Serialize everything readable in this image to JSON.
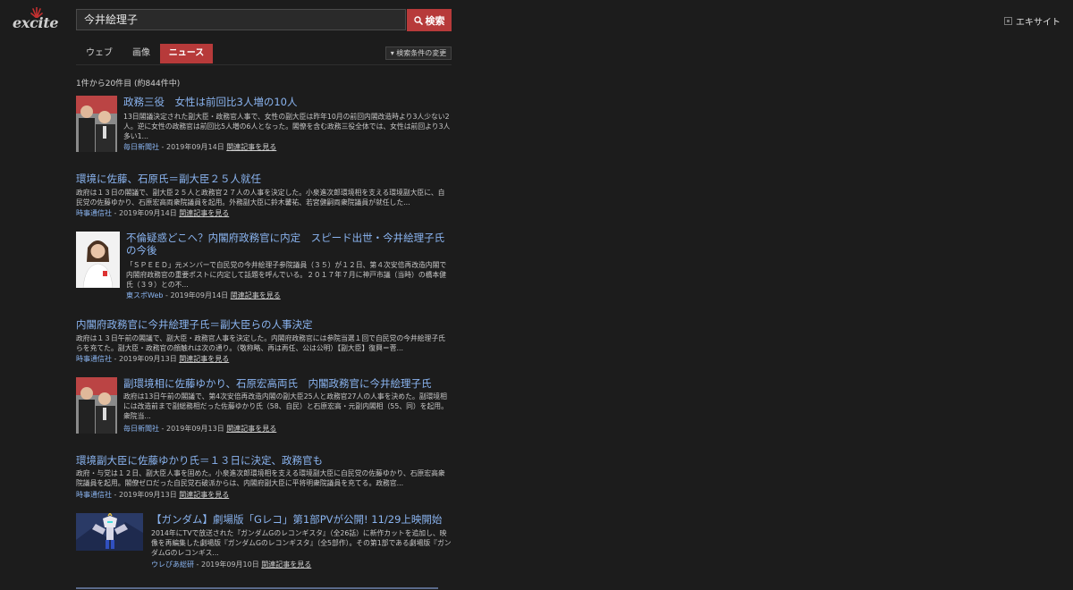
{
  "header": {
    "logo_text": "excite",
    "search_value": "今井絵理子",
    "search_button_label": "検索",
    "site_link_label": "エキサイト"
  },
  "tabs": [
    {
      "label": "ウェブ",
      "active": false
    },
    {
      "label": "画像",
      "active": false
    },
    {
      "label": "ニュース",
      "active": true
    }
  ],
  "filter_label": "検索条件の変更",
  "result_count": "1件から20件目 (約844件中)",
  "related_label": "関連記事を見る",
  "colors": {
    "accent": "#b73a3a",
    "link": "#8ab4f0",
    "background": "#1c1c1c"
  },
  "results": [
    {
      "title": "政務三役　女性は前回比3人増の10人",
      "snippet": "13日閣議決定された副大臣・政務官人事で、女性の副大臣は昨年10月の前回内閣改造時より3人少ない2人。逆に女性の政務官は前回比5人増の6人となった。閣僚を含む政務三役全体では、女性は前回より3人多い1...",
      "source": "毎日新聞社",
      "date": "2019年09月14日",
      "thumbnail": "group-photo"
    },
    {
      "title": "環境に佐藤、石原氏＝副大臣２５人就任",
      "snippet": "政府は１３日の閣議で、副大臣２５人と政務官２７人の人事を決定した。小泉進次郎環境相を支える環境副大臣に、自民党の佐藤ゆかり、石原宏高両衆院議員を起用。外務副大臣に鈴木馨祐、若宮健嗣両衆院議員が就任した...",
      "source": "時事通信社",
      "date": "2019年09月14日"
    },
    {
      "title": "不倫疑惑どこへ？内閣府政務官に内定　スピード出世・今井絵理子氏の今後",
      "snippet": "「ＳＰＥＥＤ」元メンバーで自民党の今井絵理子参院議員（３５）が１２日、第４次安倍再改造内閣で内閣府政務官の重要ポストに内定して話題を呼んでいる。２０１７年７月に神戸市議（当時）の橋本健氏（３９）との不...",
      "source": "東スポWeb",
      "date": "2019年09月14日",
      "thumbnail": "portrait"
    },
    {
      "title": "内閣府政務官に今井絵理子氏＝副大臣らの人事決定",
      "snippet": "政府は１３日午前の閣議で、副大臣・政務官人事を決定した。内閣府政務官には参院当選１回で自民党の今井絵理子氏らを充てた。副大臣・政務官の顔触れは次の通り。（敬称略、再は再任、公は公明）【副大臣】復興＝菅...",
      "source": "時事通信社",
      "date": "2019年09月13日"
    },
    {
      "title": "副環境相に佐藤ゆかり、石原宏高両氏　内閣政務官に今井絵理子氏",
      "snippet": "政府は13日午前の閣議で、第4次安倍再改造内閣の副大臣25人と政務官27人の人事を決めた。副環境相には改造前まで副総務相だった佐藤ゆかり氏（58、自民）と石原宏高・元副内閣相（55、同）を起用。衆院当...",
      "source": "毎日新聞社",
      "date": "2019年09月13日",
      "thumbnail": "group-photo"
    },
    {
      "title": "環境副大臣に佐藤ゆかり氏＝１３日に決定、政務官も",
      "snippet": "政府・与党は１２日、副大臣人事を固めた。小泉進次郎環境相を支える環境副大臣に自民党の佐藤ゆかり、石原宏高衆院議員を起用。閣僚ゼロだった自民党石破派からは、内閣府副大臣に平将明衆院議員を充てる。政務官...",
      "source": "時事通信社",
      "date": "2019年09月13日"
    },
    {
      "title": "【ガンダム】劇場版「Gレコ」第1部PVが公開! 11/29上映開始",
      "snippet": "2014年にTVで放送された『ガンダムGのレコンギスタ』（全26話）に新作カットを追加し、映像を再編集した劇場版『ガンダムGのレコンギスタ』（全5部作）。その第1部である劇場版『ガンダムGのレコンギス...",
      "source": "ウレぴあ総研",
      "date": "2019年09月10日",
      "thumbnail": "gundam"
    }
  ]
}
